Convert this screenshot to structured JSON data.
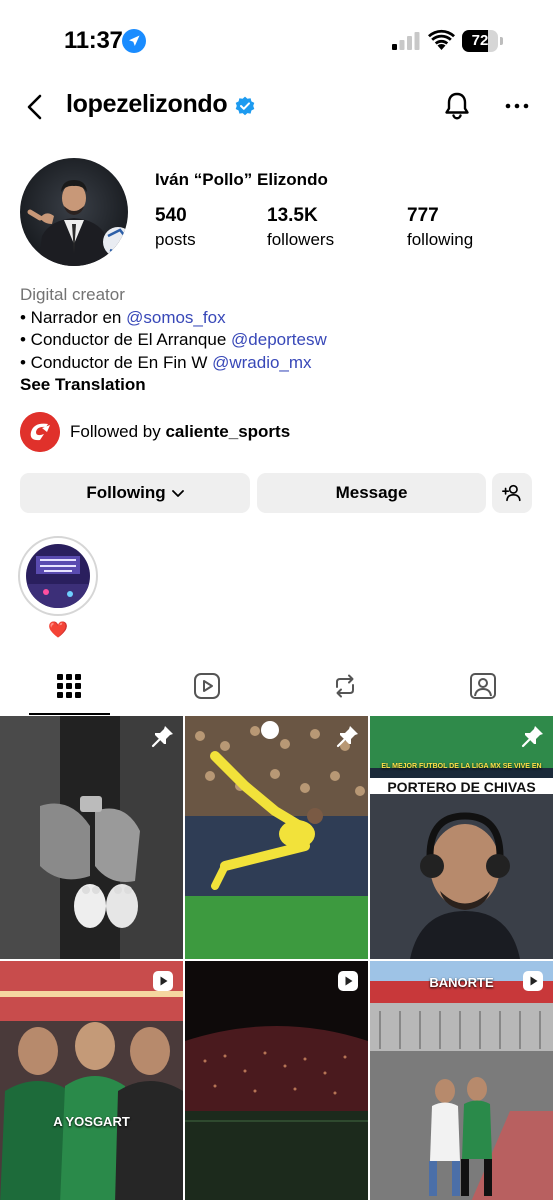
{
  "status_bar": {
    "time": "11:37",
    "battery": "72",
    "battery_level": 0.72
  },
  "header": {
    "username": "lopezelizondo",
    "verified": true
  },
  "profile": {
    "full_name": "Iván “Pollo” Elizondo",
    "stats": [
      {
        "value": "540",
        "label": "posts"
      },
      {
        "value": "13.5K",
        "label": "followers"
      },
      {
        "value": "777",
        "label": "following"
      }
    ],
    "bio": {
      "category": "Digital creator",
      "lines": [
        {
          "prefix": "• Narrador en ",
          "mention": "@somos_fox"
        },
        {
          "prefix": "• Conductor de El Arranque ",
          "mention": "@deportesw"
        },
        {
          "prefix": "• Conductor de En Fin W ",
          "mention": "@wradio_mx"
        }
      ],
      "see_translation": "See Translation"
    },
    "followed_by": {
      "prefix": "Followed by ",
      "account": "caliente_sports"
    }
  },
  "actions": {
    "following": "Following",
    "message": "Message"
  },
  "highlights": [
    {
      "label": "❤️"
    }
  ],
  "tabs": [
    {
      "name": "grid",
      "icon": "grid-icon",
      "active": true
    },
    {
      "name": "reels",
      "icon": "reels-icon",
      "active": false
    },
    {
      "name": "reposts",
      "icon": "repost-icon",
      "active": false
    },
    {
      "name": "tagged",
      "icon": "tagged-icon",
      "active": false
    }
  ],
  "posts": [
    {
      "type": "pinned",
      "caption": ""
    },
    {
      "type": "pinned",
      "caption": ""
    },
    {
      "type": "pinned",
      "caption": "PORTERO DE CHIVAS",
      "top_banner": "EL MEJOR FUTBOL DE LA LIGA MX SE VIVE EN"
    },
    {
      "type": "reel",
      "caption": "A YOSGART"
    },
    {
      "type": "reel",
      "caption": ""
    },
    {
      "type": "reel",
      "caption": "",
      "sign": "BANORTE"
    }
  ],
  "colors": {
    "mention": "#3848b8",
    "verified": "#1d9bf0",
    "button_bg": "#efefef",
    "location": "#1a8cff"
  }
}
